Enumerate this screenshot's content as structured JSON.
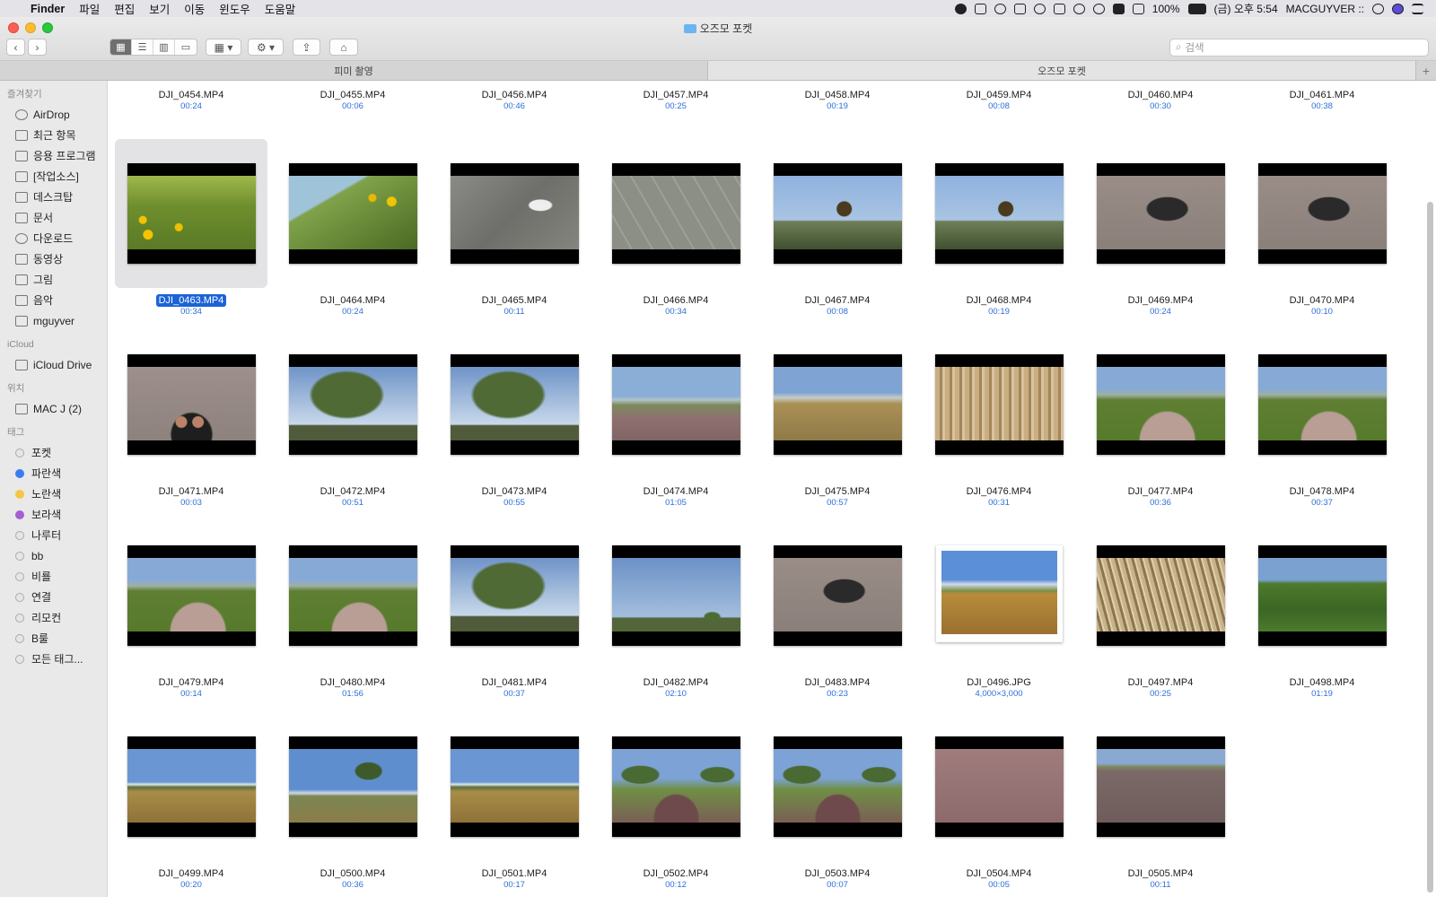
{
  "menubar": {
    "apple": "",
    "app": "Finder",
    "menus": [
      "파일",
      "편집",
      "보기",
      "이동",
      "윈도우",
      "도움말"
    ],
    "battery": "100%",
    "datetime": "(금) 오후 5:54",
    "user": "MACGUYVER ::"
  },
  "window": {
    "title": "오즈모 포켓",
    "search_placeholder": "검색",
    "tabs": [
      "피미 촬영",
      "오즈모 포켓"
    ],
    "new_tab": "+"
  },
  "sidebar": {
    "favorites_header": "즐겨찾기",
    "favorites": [
      "AirDrop",
      "최근 항목",
      "응용 프로그램",
      "[작업소스]",
      "데스크탑",
      "문서",
      "다운로드",
      "동영상",
      "그림",
      "음악",
      "mguyver"
    ],
    "icloud_header": "iCloud",
    "icloud": [
      "iCloud Drive"
    ],
    "locations_header": "위치",
    "locations": [
      "MAC J (2)"
    ],
    "tags_header": "태그",
    "tags": [
      {
        "label": "포켓",
        "color": ""
      },
      {
        "label": "파란색",
        "color": "#3b7cf0"
      },
      {
        "label": "노란색",
        "color": "#f6c544"
      },
      {
        "label": "보라색",
        "color": "#a55fd1"
      },
      {
        "label": "나루터",
        "color": ""
      },
      {
        "label": "bb",
        "color": ""
      },
      {
        "label": "비룔",
        "color": ""
      },
      {
        "label": "연결",
        "color": ""
      },
      {
        "label": "리모컨",
        "color": ""
      },
      {
        "label": "B룰",
        "color": ""
      },
      {
        "label": "모든 태그...",
        "color": ""
      }
    ]
  },
  "files_top_row": [
    {
      "name": "DJI_0454.MP4",
      "meta": "00:24"
    },
    {
      "name": "DJI_0455.MP4",
      "meta": "00:06"
    },
    {
      "name": "DJI_0456.MP4",
      "meta": "00:46"
    },
    {
      "name": "DJI_0457.MP4",
      "meta": "00:25"
    },
    {
      "name": "DJI_0458.MP4",
      "meta": "00:19"
    },
    {
      "name": "DJI_0459.MP4",
      "meta": "00:08"
    },
    {
      "name": "DJI_0460.MP4",
      "meta": "00:30"
    },
    {
      "name": "DJI_0461.MP4",
      "meta": "00:38"
    }
  ],
  "files": [
    {
      "name": "DJI_0463.MP4",
      "meta": "00:34",
      "selected": true,
      "scene": "flowers"
    },
    {
      "name": "DJI_0464.MP4",
      "meta": "00:24",
      "scene": "grass-flowers"
    },
    {
      "name": "DJI_0465.MP4",
      "meta": "00:11",
      "scene": "shoes-pavement"
    },
    {
      "name": "DJI_0466.MP4",
      "meta": "00:34",
      "scene": "pavement"
    },
    {
      "name": "DJI_0467.MP4",
      "meta": "00:08",
      "scene": "pinwheel-sky"
    },
    {
      "name": "DJI_0468.MP4",
      "meta": "00:19",
      "scene": "pinwheel-sky"
    },
    {
      "name": "DJI_0469.MP4",
      "meta": "00:24",
      "scene": "legs-ground"
    },
    {
      "name": "DJI_0470.MP4",
      "meta": "00:10",
      "scene": "legs-ground"
    },
    {
      "name": "DJI_0471.MP4",
      "meta": "00:03",
      "scene": "feet-ground"
    },
    {
      "name": "DJI_0472.MP4",
      "meta": "00:51",
      "scene": "tree-sky"
    },
    {
      "name": "DJI_0473.MP4",
      "meta": "00:55",
      "scene": "tree-sky"
    },
    {
      "name": "DJI_0474.MP4",
      "meta": "01:05",
      "scene": "path-field"
    },
    {
      "name": "DJI_0475.MP4",
      "meta": "00:57",
      "scene": "dry-field"
    },
    {
      "name": "DJI_0476.MP4",
      "meta": "00:31",
      "scene": "reeds"
    },
    {
      "name": "DJI_0477.MP4",
      "meta": "00:36",
      "scene": "green-path"
    },
    {
      "name": "DJI_0478.MP4",
      "meta": "00:37",
      "scene": "green-path"
    },
    {
      "name": "DJI_0479.MP4",
      "meta": "00:14",
      "scene": "green-path"
    },
    {
      "name": "DJI_0480.MP4",
      "meta": "01:56",
      "scene": "green-path"
    },
    {
      "name": "DJI_0481.MP4",
      "meta": "00:37",
      "scene": "tree-sky"
    },
    {
      "name": "DJI_0482.MP4",
      "meta": "02:10",
      "scene": "sky-small-tree"
    },
    {
      "name": "DJI_0483.MP4",
      "meta": "00:23",
      "scene": "legs-ground"
    },
    {
      "name": "DJI_0496.JPG",
      "meta": "4,000×3,000",
      "photo": true,
      "scene": "wheat-photo"
    },
    {
      "name": "DJI_0497.MP4",
      "meta": "00:25",
      "scene": "wheat-close"
    },
    {
      "name": "DJI_0498.MP4",
      "meta": "01:19",
      "scene": "grass-hill"
    },
    {
      "name": "DJI_0499.MP4",
      "meta": "00:20",
      "scene": "wheat-field"
    },
    {
      "name": "DJI_0500.MP4",
      "meta": "00:36",
      "scene": "tree-field"
    },
    {
      "name": "DJI_0501.MP4",
      "meta": "00:17",
      "scene": "wheat-field"
    },
    {
      "name": "DJI_0502.MP4",
      "meta": "00:12",
      "scene": "trees-path"
    },
    {
      "name": "DJI_0503.MP4",
      "meta": "00:07",
      "scene": "trees-path"
    },
    {
      "name": "DJI_0504.MP4",
      "meta": "00:05",
      "scene": "red-ground"
    },
    {
      "name": "DJI_0505.MP4",
      "meta": "00:11",
      "scene": "red-ground-horizon"
    }
  ]
}
